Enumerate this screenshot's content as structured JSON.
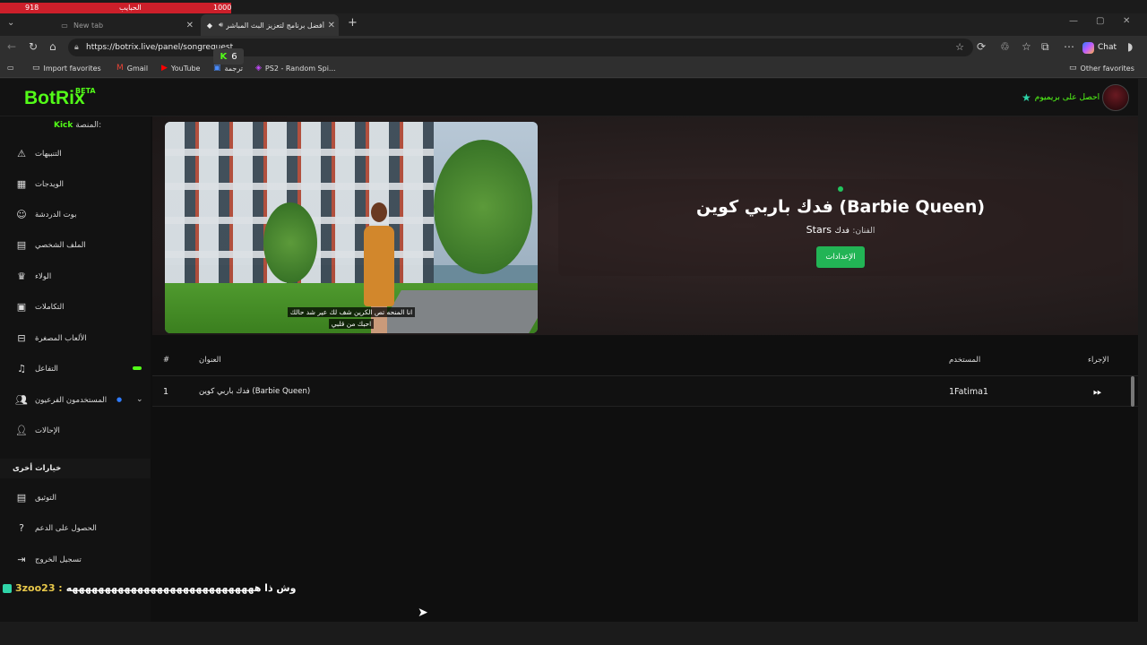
{
  "overlay": {
    "left_count": "918",
    "label": "الحبايب",
    "right_count": "1000"
  },
  "browser": {
    "tabs": [
      {
        "label": "New tab",
        "icon": "page-icon"
      },
      {
        "label": "أفضل برنامج لتعزيز البث المباشر",
        "icon": "botrix-icon"
      }
    ],
    "new_tab": "+",
    "url": "https://botrix.live/panel/songrequest",
    "chat_label": "Chat",
    "bookmarks": [
      "Import favorites",
      "Gmail",
      "YouTube",
      "ترجمة",
      "PS2 - Random Spi..."
    ],
    "other_favorites": "Other favorites",
    "kick_badge_count": "6"
  },
  "header": {
    "logo": "BotRix",
    "beta": "BETA",
    "premium_label": "احصل على بريميوم"
  },
  "sidebar": {
    "platform_label": "المنصة:",
    "platform_value": "Kick",
    "items": [
      {
        "label": "التنبيهات",
        "icon": "warning-icon"
      },
      {
        "label": "الويدجات",
        "icon": "widgets-icon"
      },
      {
        "label": "بوت الدردشة",
        "icon": "robot-icon"
      },
      {
        "label": "الملف الشخصي",
        "icon": "id-card-icon"
      },
      {
        "label": "الولاء",
        "icon": "trophy-icon"
      },
      {
        "label": "التكاملات",
        "icon": "integrations-icon"
      },
      {
        "label": "الألعاب المصغرة",
        "icon": "gamepad-icon"
      },
      {
        "label": "التفاعل",
        "icon": "music-icon"
      },
      {
        "label": "المستخدمون الفرعيون",
        "icon": "users-icon"
      },
      {
        "label": "الإحالات",
        "icon": "referrals-icon"
      }
    ],
    "section_title": "خيارات أخرى",
    "other_items": [
      {
        "label": "التوثيق",
        "icon": "docs-icon"
      },
      {
        "label": "الحصول على الدعم",
        "icon": "help-icon"
      },
      {
        "label": "تسجيل الخروج",
        "icon": "logout-icon"
      }
    ]
  },
  "player": {
    "subtitle_line1": "انا المنحه تص الكرين شف لك عير شد حالك",
    "subtitle_line2": "احبك من قلبي"
  },
  "now_playing": {
    "title": "فدك باربي كوين (Barbie Queen)",
    "artist_label": "الفنان:",
    "artist_value": "فدك",
    "artist_extra": "Stars",
    "settings_button": "الإعدادات"
  },
  "queue": {
    "columns": {
      "index": "#",
      "title": "العنوان",
      "user": "المستخدم",
      "action": "الإجراء"
    },
    "rows": [
      {
        "index": "1",
        "title": "فدك باربي كوين (Barbie Queen)",
        "user": "1Fatima1"
      }
    ]
  },
  "chat_overlay": {
    "user": "3zoo23 :",
    "message": "وش ذا هههههههههههههههههههههههههههههه"
  },
  "colors": {
    "accent": "#53fc18",
    "button": "#22b455",
    "live_dot": "#22c55e"
  }
}
